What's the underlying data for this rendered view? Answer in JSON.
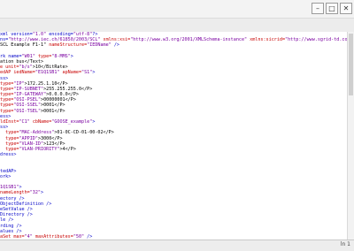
{
  "window": {
    "controls": {
      "minimize": "–",
      "maximize": "□",
      "close": "✕"
    }
  },
  "editor": {
    "lines": [
      [
        {
          "t": "tag",
          "v": "xml version="
        },
        {
          "t": "val",
          "v": "\"1.0\""
        },
        {
          "t": "tag",
          "v": " encoding="
        },
        {
          "t": "val",
          "v": "\"utf-8\""
        },
        {
          "t": "tag",
          "v": "?>"
        }
      ],
      [
        {
          "t": "tag",
          "v": "ns="
        },
        {
          "t": "val",
          "v": "\"http://www.iec.ch/61850/2003/SCL\""
        },
        {
          "t": "attr",
          "v": " xmlns:xsi="
        },
        {
          "t": "val",
          "v": "\"http://www.w3.org/2001/XMLSchema-instance\""
        },
        {
          "t": "attr",
          "v": " xmlns:sicrid="
        },
        {
          "t": "val",
          "v": "\"http://www.sgrid-td.com/SCL.ext\""
        }
      ],
      [
        {
          "t": "txt",
          "v": "SCL Example F1-1\""
        },
        {
          "t": "attr",
          "v": " nameStructure="
        },
        {
          "t": "val",
          "v": "\"IEDName\""
        },
        {
          "t": "tag",
          "v": " />"
        }
      ],
      [
        {
          "t": "txt",
          "v": ""
        }
      ],
      [
        {
          "t": "tag",
          "v": "rk name="
        },
        {
          "t": "val",
          "v": "\"W01\""
        },
        {
          "t": "attr",
          "v": " type="
        },
        {
          "t": "val",
          "v": "\"8-MMS\""
        },
        {
          "t": "tag",
          "v": ">"
        }
      ],
      [
        {
          "t": "txt",
          "v": "ation bus</Text>"
        }
      ],
      [
        {
          "t": "attr",
          "v": "e unit="
        },
        {
          "t": "val",
          "v": "\"b/s\""
        },
        {
          "t": "txt",
          "v": ">10</BitRate>"
        }
      ],
      [
        {
          "t": "attr",
          "v": "edAP iedName="
        },
        {
          "t": "val",
          "v": "\"E1Q1SB1\""
        },
        {
          "t": "attr",
          "v": " apName="
        },
        {
          "t": "val",
          "v": "\"S1\""
        },
        {
          "t": "tag",
          "v": ">"
        }
      ],
      [
        {
          "t": "tag",
          "v": "ss>"
        }
      ],
      [
        {
          "t": "attr",
          "v": "type="
        },
        {
          "t": "val",
          "v": "\"IP\""
        },
        {
          "t": "txt",
          "v": ">172.25.1.10</P>"
        }
      ],
      [
        {
          "t": "attr",
          "v": "type="
        },
        {
          "t": "val",
          "v": "\"IP-SUBNET\""
        },
        {
          "t": "txt",
          "v": ">255.255.255.0</P>"
        }
      ],
      [
        {
          "t": "attr",
          "v": "type="
        },
        {
          "t": "val",
          "v": "\"IP-GATEWAY\""
        },
        {
          "t": "txt",
          "v": ">0.0.0.0</P>"
        }
      ],
      [
        {
          "t": "attr",
          "v": "type="
        },
        {
          "t": "val",
          "v": "\"OSI-PSEL\""
        },
        {
          "t": "txt",
          "v": ">00000001</P>"
        }
      ],
      [
        {
          "t": "attr",
          "v": "type="
        },
        {
          "t": "val",
          "v": "\"OSI-SSEL\""
        },
        {
          "t": "txt",
          "v": ">0001</P>"
        }
      ],
      [
        {
          "t": "attr",
          "v": "type="
        },
        {
          "t": "val",
          "v": "\"OSI-TSEL\""
        },
        {
          "t": "txt",
          "v": ">0001</P>"
        }
      ],
      [
        {
          "t": "tag",
          "v": "ess>"
        }
      ],
      [
        {
          "t": "attr",
          "v": "ldInst="
        },
        {
          "t": "val",
          "v": "\"C1\""
        },
        {
          "t": "attr",
          "v": " cbName="
        },
        {
          "t": "val",
          "v": "\"GOOSE_example\""
        },
        {
          "t": "tag",
          "v": ">"
        }
      ],
      [
        {
          "t": "tag",
          "v": "ss>"
        }
      ],
      [
        {
          "t": "attr",
          "v": "  type="
        },
        {
          "t": "val",
          "v": "\"MAC-Address\""
        },
        {
          "t": "txt",
          "v": ">01-0C-CD-01-00-02</P>"
        }
      ],
      [
        {
          "t": "attr",
          "v": "  type="
        },
        {
          "t": "val",
          "v": "\"APPID\""
        },
        {
          "t": "txt",
          "v": ">3000</P>"
        }
      ],
      [
        {
          "t": "attr",
          "v": "  type="
        },
        {
          "t": "val",
          "v": "\"VLAN-ID\""
        },
        {
          "t": "txt",
          "v": ">123</P>"
        }
      ],
      [
        {
          "t": "attr",
          "v": "  type="
        },
        {
          "t": "val",
          "v": "\"VLAN-PRIORITY\""
        },
        {
          "t": "txt",
          "v": ">4</P>"
        }
      ],
      [
        {
          "t": "tag",
          "v": "dress>"
        }
      ],
      [
        {
          "t": "txt",
          "v": ""
        }
      ],
      [
        {
          "t": "txt",
          "v": ""
        }
      ],
      [
        {
          "t": "tag",
          "v": "tedAP>"
        }
      ],
      [
        {
          "t": "tag",
          "v": "ork>"
        }
      ],
      [
        {
          "t": "txt",
          "v": ""
        }
      ],
      [
        {
          "t": "val",
          "v": "1Q1SB1\""
        },
        {
          "t": "tag",
          "v": ">"
        }
      ],
      [
        {
          "t": "attr",
          "v": "nameLength="
        },
        {
          "t": "val",
          "v": "\"32\""
        },
        {
          "t": "tag",
          "v": ">"
        }
      ],
      [
        {
          "t": "tag",
          "v": "ectory />"
        }
      ],
      [
        {
          "t": "tag",
          "v": "ObjectDefinition />"
        }
      ],
      [
        {
          "t": "tag",
          "v": "eSetValue />"
        }
      ],
      [
        {
          "t": "tag",
          "v": "Directory />"
        }
      ],
      [
        {
          "t": "tag",
          "v": "le />"
        }
      ],
      [
        {
          "t": "tag",
          "v": "rding />"
        }
      ],
      [
        {
          "t": "tag",
          "v": "alues />"
        }
      ],
      [
        {
          "t": "attr",
          "v": "aSet max="
        },
        {
          "t": "val",
          "v": "\"4\""
        },
        {
          "t": "attr",
          "v": " maxAttributes="
        },
        {
          "t": "val",
          "v": "\"50\""
        },
        {
          "t": "tag",
          "v": " />"
        }
      ]
    ]
  },
  "statusbar": {
    "position": "ln 1"
  }
}
